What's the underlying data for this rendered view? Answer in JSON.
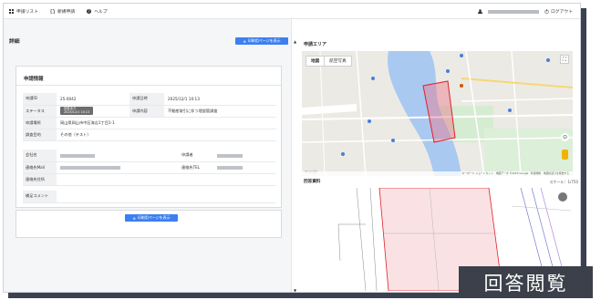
{
  "nav": {
    "items": [
      {
        "label": "申請リスト",
        "icon": "list-icon"
      },
      {
        "label": "新規申請",
        "icon": "document-icon"
      },
      {
        "label": "ヘルプ",
        "icon": "help-icon"
      }
    ],
    "logout_label": "ログアウト"
  },
  "left": {
    "section_title": "詳細",
    "print_button_label": "印刷用ページを表示",
    "card_title": "申請情報",
    "rows": [
      {
        "label1": "申請ID",
        "value1": "25-0042",
        "label2": "申請日時",
        "value2": "2025/12/1 10:13"
      },
      {
        "label1": "ステータス",
        "status_line1": "回答あり",
        "status_line2": "2025/12/1 10:13",
        "label2": "申請内容",
        "value2": "不動産取引に伴う埋設管調査"
      },
      {
        "label1": "申請場所",
        "value1": "岡山県岡山市中区海吉1丁目1-1"
      },
      {
        "label1": "調査目的",
        "value1": "その他（テスト）"
      },
      {
        "label1": "会社名",
        "label2": "申請者"
      },
      {
        "label1": "連絡先Mail",
        "label2": "連絡先TEL"
      },
      {
        "label1": "連絡先住所"
      },
      {
        "label1": "補足コメント"
      }
    ],
    "bottom_button_label": "印刷用ページを表示"
  },
  "right": {
    "map_title": "申請エリア",
    "map_tabs": [
      "地図",
      "航空写真"
    ],
    "map_logo": "Google",
    "map_footer": "キーボード ショートカット　地図データ ©2025 Google　利用規約　地図の誤りを報告する",
    "drawing_title": "回答資料",
    "scale_label": "スケール：1/750"
  },
  "badge": {
    "label": "回答閲覧"
  },
  "colors": {
    "accent": "#3c7ff0",
    "badge_bg": "#3c404a",
    "status_bg": "#6d6d6d",
    "area_outline": "#e0202a"
  }
}
